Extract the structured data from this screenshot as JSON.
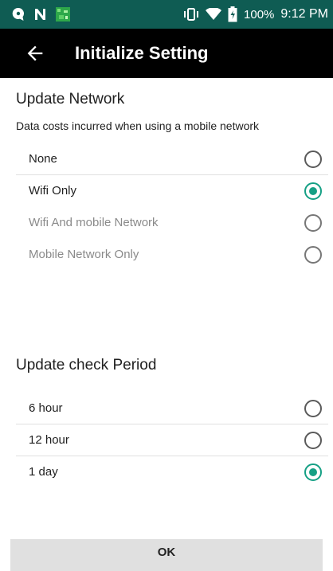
{
  "status_bar": {
    "battery_percent": "100%",
    "time": "9:12 PM",
    "icons": [
      "message-icon",
      "n-icon",
      "app-icon",
      "vibrate-icon",
      "wifi-icon",
      "battery-icon"
    ]
  },
  "app_bar": {
    "title": "Initialize Setting",
    "back_icon": "arrow-back-icon"
  },
  "update_network": {
    "title": "Update Network",
    "subtitle": "Data costs incurred when using a mobile network",
    "options": [
      {
        "label": "None",
        "selected": false,
        "enabled": true
      },
      {
        "label": "Wifi Only",
        "selected": true,
        "enabled": true
      },
      {
        "label": "Wifi And mobile Network",
        "selected": false,
        "enabled": false
      },
      {
        "label": "Mobile Network Only",
        "selected": false,
        "enabled": false
      }
    ]
  },
  "update_period": {
    "title": "Update check Period",
    "options": [
      {
        "label": "6 hour",
        "selected": false,
        "enabled": true
      },
      {
        "label": "12 hour",
        "selected": false,
        "enabled": true
      },
      {
        "label": "1 day",
        "selected": true,
        "enabled": true
      }
    ]
  },
  "ok_label": "OK",
  "colors": {
    "status_bar": "#0f5c53",
    "app_bar": "#000000",
    "accent": "#16a085"
  }
}
